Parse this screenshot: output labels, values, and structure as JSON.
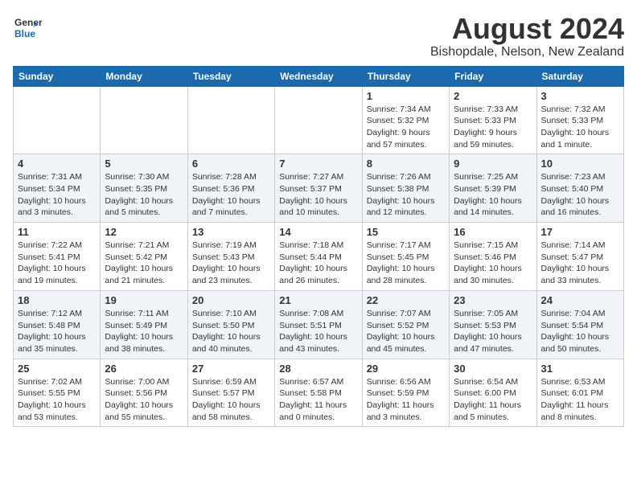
{
  "header": {
    "logo_general": "General",
    "logo_blue": "Blue",
    "month": "August 2024",
    "location": "Bishopdale, Nelson, New Zealand"
  },
  "weekdays": [
    "Sunday",
    "Monday",
    "Tuesday",
    "Wednesday",
    "Thursday",
    "Friday",
    "Saturday"
  ],
  "weeks": [
    [
      {
        "day": "",
        "info": ""
      },
      {
        "day": "",
        "info": ""
      },
      {
        "day": "",
        "info": ""
      },
      {
        "day": "",
        "info": ""
      },
      {
        "day": "1",
        "info": "Sunrise: 7:34 AM\nSunset: 5:32 PM\nDaylight: 9 hours and 57 minutes."
      },
      {
        "day": "2",
        "info": "Sunrise: 7:33 AM\nSunset: 5:33 PM\nDaylight: 9 hours and 59 minutes."
      },
      {
        "day": "3",
        "info": "Sunrise: 7:32 AM\nSunset: 5:33 PM\nDaylight: 10 hours and 1 minute."
      }
    ],
    [
      {
        "day": "4",
        "info": "Sunrise: 7:31 AM\nSunset: 5:34 PM\nDaylight: 10 hours and 3 minutes."
      },
      {
        "day": "5",
        "info": "Sunrise: 7:30 AM\nSunset: 5:35 PM\nDaylight: 10 hours and 5 minutes."
      },
      {
        "day": "6",
        "info": "Sunrise: 7:28 AM\nSunset: 5:36 PM\nDaylight: 10 hours and 7 minutes."
      },
      {
        "day": "7",
        "info": "Sunrise: 7:27 AM\nSunset: 5:37 PM\nDaylight: 10 hours and 10 minutes."
      },
      {
        "day": "8",
        "info": "Sunrise: 7:26 AM\nSunset: 5:38 PM\nDaylight: 10 hours and 12 minutes."
      },
      {
        "day": "9",
        "info": "Sunrise: 7:25 AM\nSunset: 5:39 PM\nDaylight: 10 hours and 14 minutes."
      },
      {
        "day": "10",
        "info": "Sunrise: 7:23 AM\nSunset: 5:40 PM\nDaylight: 10 hours and 16 minutes."
      }
    ],
    [
      {
        "day": "11",
        "info": "Sunrise: 7:22 AM\nSunset: 5:41 PM\nDaylight: 10 hours and 19 minutes."
      },
      {
        "day": "12",
        "info": "Sunrise: 7:21 AM\nSunset: 5:42 PM\nDaylight: 10 hours and 21 minutes."
      },
      {
        "day": "13",
        "info": "Sunrise: 7:19 AM\nSunset: 5:43 PM\nDaylight: 10 hours and 23 minutes."
      },
      {
        "day": "14",
        "info": "Sunrise: 7:18 AM\nSunset: 5:44 PM\nDaylight: 10 hours and 26 minutes."
      },
      {
        "day": "15",
        "info": "Sunrise: 7:17 AM\nSunset: 5:45 PM\nDaylight: 10 hours and 28 minutes."
      },
      {
        "day": "16",
        "info": "Sunrise: 7:15 AM\nSunset: 5:46 PM\nDaylight: 10 hours and 30 minutes."
      },
      {
        "day": "17",
        "info": "Sunrise: 7:14 AM\nSunset: 5:47 PM\nDaylight: 10 hours and 33 minutes."
      }
    ],
    [
      {
        "day": "18",
        "info": "Sunrise: 7:12 AM\nSunset: 5:48 PM\nDaylight: 10 hours and 35 minutes."
      },
      {
        "day": "19",
        "info": "Sunrise: 7:11 AM\nSunset: 5:49 PM\nDaylight: 10 hours and 38 minutes."
      },
      {
        "day": "20",
        "info": "Sunrise: 7:10 AM\nSunset: 5:50 PM\nDaylight: 10 hours and 40 minutes."
      },
      {
        "day": "21",
        "info": "Sunrise: 7:08 AM\nSunset: 5:51 PM\nDaylight: 10 hours and 43 minutes."
      },
      {
        "day": "22",
        "info": "Sunrise: 7:07 AM\nSunset: 5:52 PM\nDaylight: 10 hours and 45 minutes."
      },
      {
        "day": "23",
        "info": "Sunrise: 7:05 AM\nSunset: 5:53 PM\nDaylight: 10 hours and 47 minutes."
      },
      {
        "day": "24",
        "info": "Sunrise: 7:04 AM\nSunset: 5:54 PM\nDaylight: 10 hours and 50 minutes."
      }
    ],
    [
      {
        "day": "25",
        "info": "Sunrise: 7:02 AM\nSunset: 5:55 PM\nDaylight: 10 hours and 53 minutes."
      },
      {
        "day": "26",
        "info": "Sunrise: 7:00 AM\nSunset: 5:56 PM\nDaylight: 10 hours and 55 minutes."
      },
      {
        "day": "27",
        "info": "Sunrise: 6:59 AM\nSunset: 5:57 PM\nDaylight: 10 hours and 58 minutes."
      },
      {
        "day": "28",
        "info": "Sunrise: 6:57 AM\nSunset: 5:58 PM\nDaylight: 11 hours and 0 minutes."
      },
      {
        "day": "29",
        "info": "Sunrise: 6:56 AM\nSunset: 5:59 PM\nDaylight: 11 hours and 3 minutes."
      },
      {
        "day": "30",
        "info": "Sunrise: 6:54 AM\nSunset: 6:00 PM\nDaylight: 11 hours and 5 minutes."
      },
      {
        "day": "31",
        "info": "Sunrise: 6:53 AM\nSunset: 6:01 PM\nDaylight: 11 hours and 8 minutes."
      }
    ]
  ]
}
